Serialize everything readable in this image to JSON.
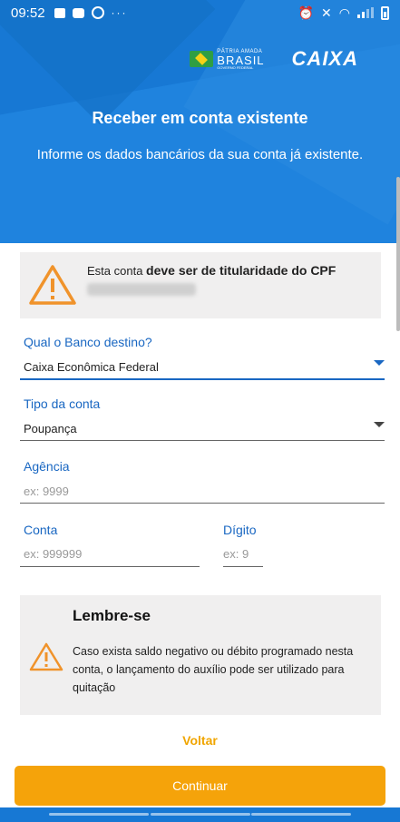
{
  "status_bar": {
    "time": "09:52",
    "dots": "···"
  },
  "header": {
    "gov_logo_small": "PÁTRIA AMADA",
    "gov_logo_big": "BRASIL",
    "gov_logo_tiny": "GOVERNO FEDERAL",
    "brand": "CAIXA",
    "title": "Receber em conta existente",
    "subtitle": "Informe os dados bancários da sua conta já existente."
  },
  "notice": {
    "text_prefix": "Esta conta ",
    "text_bold": "deve ser de titularidade do CPF"
  },
  "form": {
    "bank_label": "Qual o Banco destino?",
    "bank_value": "Caixa Econômica Federal",
    "account_type_label": "Tipo da conta",
    "account_type_value": "Poupança",
    "agency_label": "Agência",
    "agency_placeholder": "ex: 9999",
    "account_label": "Conta",
    "account_placeholder": "ex: 999999",
    "digit_label": "Dígito",
    "digit_placeholder": "ex: 9"
  },
  "reminder": {
    "title": "Lembre-se",
    "text": "Caso exista saldo negativo ou débito programado nesta conta, o lançamento do auxílio pode ser utilizado para quitação"
  },
  "actions": {
    "back_label": "Voltar",
    "continue_label": "Continuar"
  },
  "colors": {
    "header_blue": "#1778d4",
    "label_blue": "#1967c2",
    "accent_orange": "#f5a30a",
    "warning_orange": "#f0932b"
  }
}
